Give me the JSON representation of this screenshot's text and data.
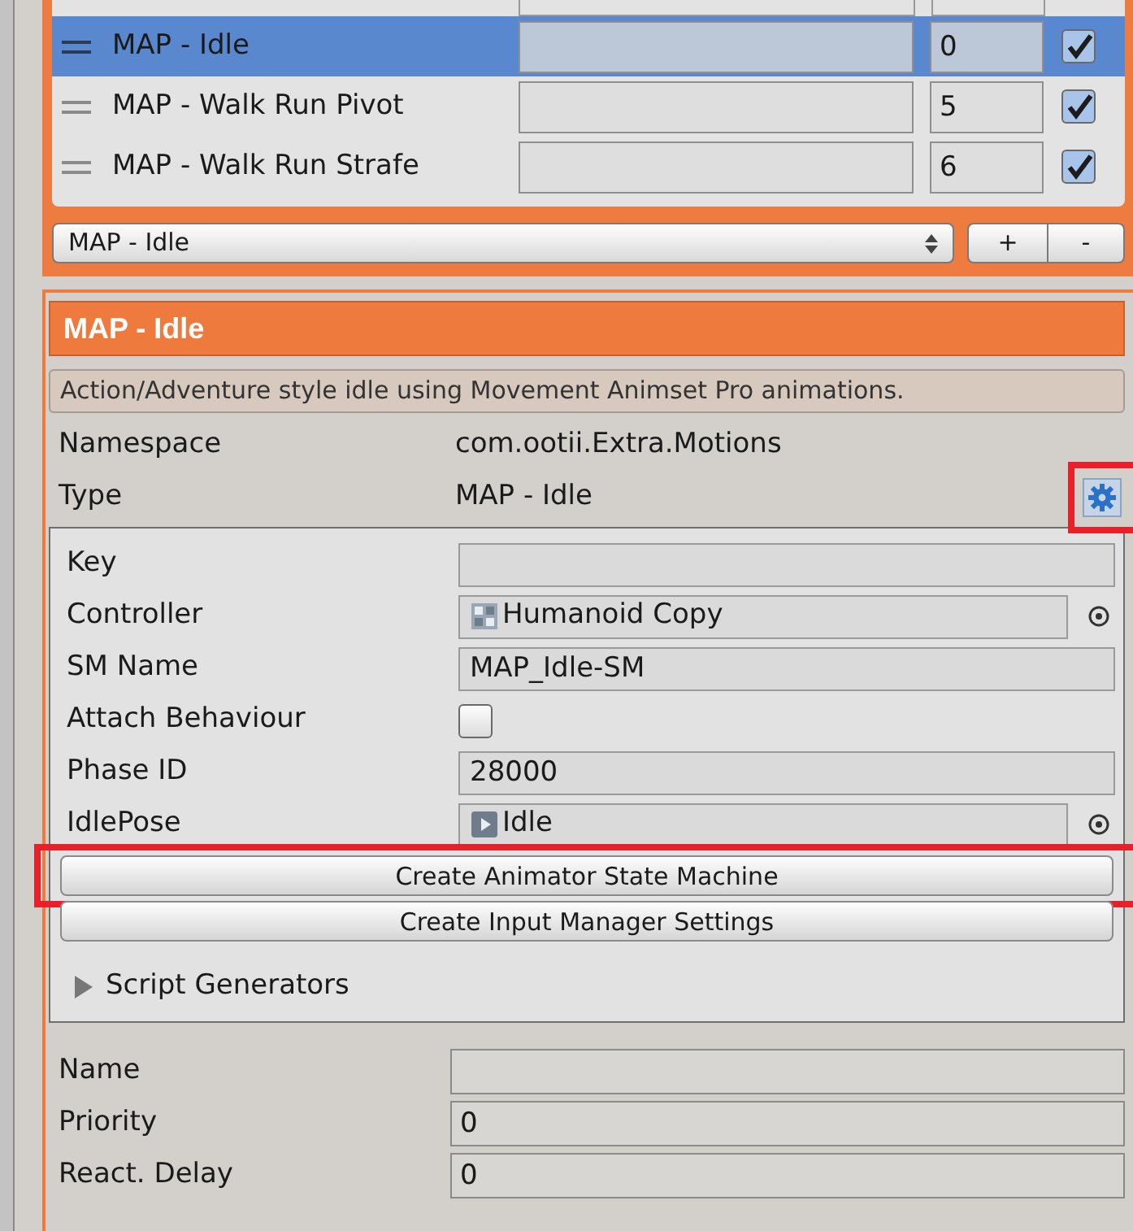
{
  "list": {
    "items": [
      {
        "name": "MAP - Idle",
        "priority": "0",
        "enabled": true,
        "selected": true
      },
      {
        "name": "MAP - Walk Run Pivot",
        "priority": "5",
        "enabled": true,
        "selected": false
      },
      {
        "name": "MAP - Walk Run Strafe",
        "priority": "6",
        "enabled": true,
        "selected": false
      }
    ]
  },
  "footer": {
    "dropdown": "MAP - Idle",
    "add": "+",
    "remove": "-"
  },
  "motion": {
    "title": "MAP - Idle",
    "description": "Action/Adventure style idle using Movement Animset Pro animations.",
    "namespace_label": "Namespace",
    "namespace": "com.ootii.Extra.Motions",
    "type_label": "Type",
    "type": "MAP - Idle",
    "settings_highlighted": true,
    "properties": [
      {
        "kind": "text",
        "label": "Key"
      },
      {
        "kind": "controller",
        "label": "Controller",
        "value": "Humanoid Copy"
      },
      {
        "kind": "text",
        "label": "SM Name",
        "value": "MAP_Idle-SM"
      },
      {
        "kind": "checkbox",
        "label": "Attach Behaviour",
        "checked": false
      },
      {
        "kind": "text",
        "label": "Phase ID",
        "value": "28000"
      },
      {
        "kind": "clip",
        "label": "IdlePose",
        "value": "Idle"
      }
    ],
    "buttons": [
      {
        "label": "Create Animator State Machine",
        "highlighted": true
      },
      {
        "label": "Create Input Manager Settings",
        "highlighted": false
      }
    ],
    "foldout": {
      "label": "Script Generators",
      "expanded": false
    },
    "fields": [
      {
        "label": "Name"
      },
      {
        "label": "Priority",
        "value": "0"
      },
      {
        "label": "React. Delay",
        "value": "0"
      }
    ]
  }
}
